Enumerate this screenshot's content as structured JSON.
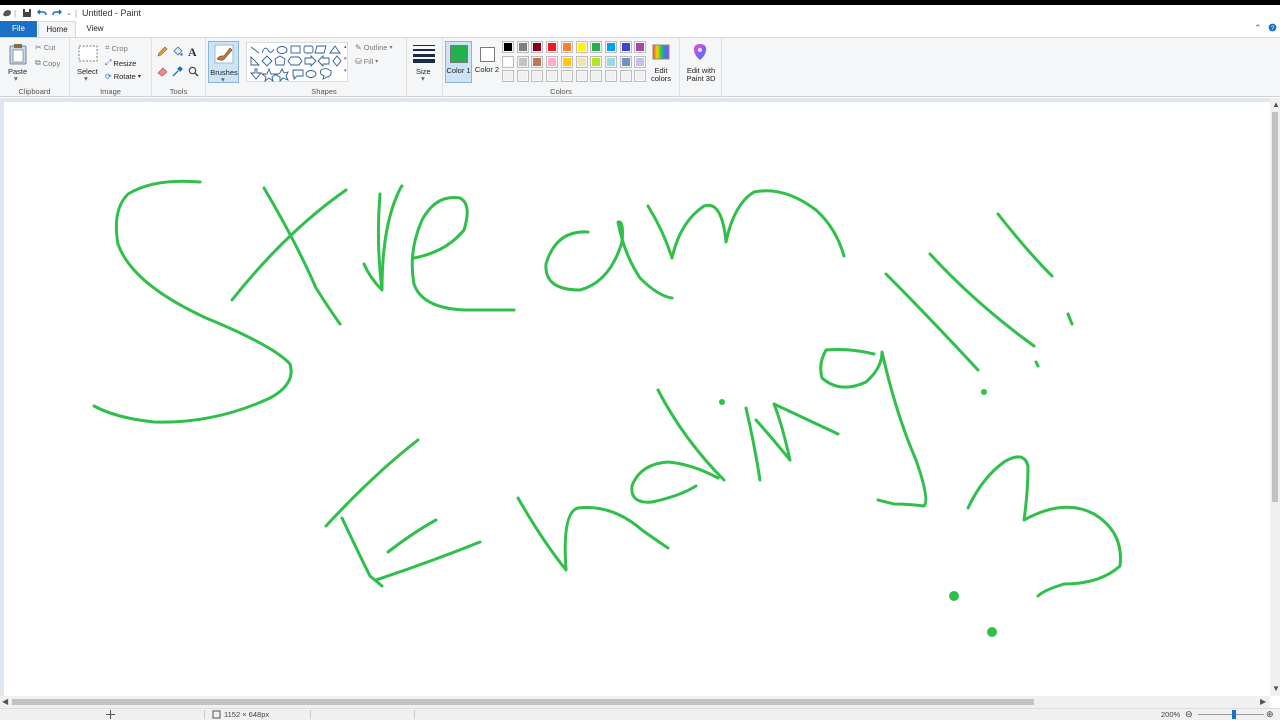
{
  "window": {
    "title": "Untitled - Paint"
  },
  "tabs": {
    "file": "File",
    "home": "Home",
    "view": "View"
  },
  "ribbon": {
    "clipboard": {
      "label": "Clipboard",
      "paste": "Paste",
      "cut": "Cut",
      "copy": "Copy"
    },
    "image": {
      "label": "Image",
      "select": "Select",
      "crop": "Crop",
      "resize": "Resize",
      "rotate": "Rotate"
    },
    "tools": {
      "label": "Tools"
    },
    "brushes": {
      "label": "Brushes"
    },
    "shapes": {
      "label": "Shapes",
      "outline": "Outline",
      "fill": "Fill"
    },
    "size": {
      "label": "Size"
    },
    "colors": {
      "label": "Colors",
      "color1": "Color 1",
      "color2": "Color 2",
      "edit_colors": "Edit colors",
      "color1_value": "#22b14c",
      "color2_value": "#ffffff",
      "palette_row1": [
        "#000000",
        "#7f7f7f",
        "#880015",
        "#ed1c24",
        "#ff7f27",
        "#fff200",
        "#22b14c",
        "#00a2e8",
        "#3f48cc",
        "#a349a4"
      ],
      "palette_row2": [
        "#ffffff",
        "#c3c3c3",
        "#b97a57",
        "#ffaec9",
        "#ffc90e",
        "#efe4b0",
        "#b5e61d",
        "#99d9ea",
        "#7092be",
        "#c8bfe7"
      ],
      "palette_row3": [
        "#f0f0f0",
        "#f0f0f0",
        "#f0f0f0",
        "#f0f0f0",
        "#f0f0f0",
        "#f0f0f0",
        "#f0f0f0",
        "#f0f0f0",
        "#f0f0f0",
        "#f0f0f0"
      ]
    },
    "paint3d": {
      "label": "Edit with Paint 3D"
    }
  },
  "status": {
    "dimensions": "1152 × 648px",
    "zoom": "200%"
  },
  "drawing": {
    "stroke_color": "#2fbf4a"
  }
}
